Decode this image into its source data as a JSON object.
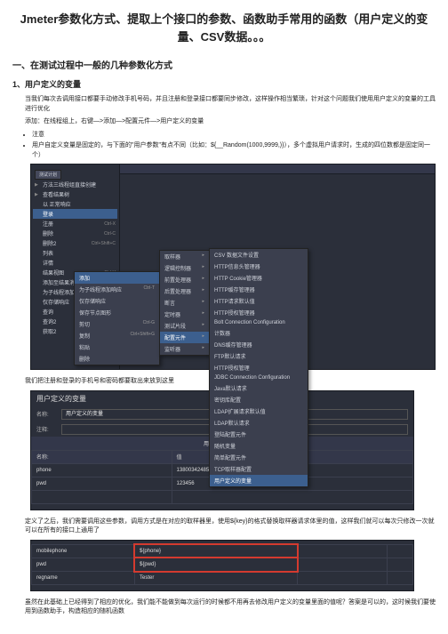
{
  "title": "Jmeter参数化方式、提取上个接口的参数、函数助手常用的函数（用户定义的变量、CSV数据。。。",
  "sec1_h2": "一、在测试过程中一般的几种参数化方式",
  "sec1_h3": "1、用户定义的变量",
  "p1": "当我们每次去调用接口都要手动修改手机号码，并且注册和登录接口都要同步修改，这样操作相当繁琐，针对这个问题我们使用用户定义的变量的工具进行优化",
  "p2": "添加：在线程组上，右键—>添加—>配置元件—>用户定义的变量",
  "b1": "注意",
  "b2": "用户自定义变量是固定的，与下面的\"用户参数\"有点不同（比如：${__Random(1000,9999,)}），多个虚拟用户请求时，生成的四位数都是固定同一个）",
  "tree": [
    "测试计划",
    "▶ 方法三线程组直接创建",
    "▶ 查看结果树",
    "以 正常响应",
    "登录",
    "注册",
    "删除",
    "删除2",
    "列表",
    "详情",
    "结果视图",
    "添加至结果消息",
    "为子线程添加响应断言",
    "仅存储响应",
    "查询",
    "查询2",
    "获取2"
  ],
  "tree_keys": [
    "",
    "",
    "",
    "",
    "",
    "Ctrl-X",
    "Ctrl-C",
    "Ctrl+Shift+C",
    "",
    "",
    "Ctrl-V",
    "",
    "",
    "",
    "",
    "",
    ""
  ],
  "ctx1": [
    [
      "添加",
      ""
    ],
    [
      "为子线程添加响应",
      "Ctrl-T"
    ],
    [
      "仅存储响应",
      ""
    ],
    [
      "保存节点图形",
      ""
    ],
    [
      "剪切",
      "Ctrl-G"
    ],
    [
      "复制",
      "Ctrl+Shift+G"
    ],
    [
      "粘贴",
      ""
    ],
    [
      "删除",
      ""
    ]
  ],
  "ctx2": [
    "取样器",
    "逻辑控制器",
    "前置处理器",
    "后置处理器",
    "断言",
    "定时器",
    "测试片段",
    "配置元件",
    "监听器"
  ],
  "ctx2_hl_index": 7,
  "ctx3": [
    "CSV 数据文件设置",
    "HTTP信息头管理器",
    "HTTP Cookie管理器",
    "HTTP缓存管理器",
    "HTTP请求默认值",
    "HTTP授权管理器",
    "Bolt Connection Configuration",
    "计数器",
    "DNS缓存管理器",
    "FTP默认请求",
    "HTTP授权管理",
    "JDBC Connection Configuration",
    "Java默认请求",
    "密钥库配置",
    "LDAP扩展请求默认值",
    "LDAP默认请求",
    "登陆配置元件",
    "随机变量",
    "简单配置元件",
    "TCP取样器配置",
    "用户定义的变量"
  ],
  "p3": "我们把注册和登录的手机号和密码都要取出来放到这里",
  "shot2": {
    "panelTitle": "用户定义的变量",
    "labelName": "名称:",
    "fieldName": "用户定义的变量",
    "labelComment": "注释:",
    "tableTitle": "用户定义的变量",
    "cols": [
      "名称:",
      "值"
    ],
    "rows": [
      [
        "phone",
        "13800342485"
      ],
      [
        "pwd",
        "123456"
      ]
    ]
  },
  "p4": "定义了之后，我们需要调用这些参数，调用方式是在对应的取样器里，使用${key}的格式替换取样器请求体里的值，这样我们就可以每次只修改一次就可以在所有的接口上通用了",
  "shot3": {
    "rows": [
      [
        "mobilephone",
        "${phone}"
      ],
      [
        "pwd",
        "${pwd}"
      ],
      [
        "regname",
        "Tester"
      ]
    ]
  },
  "p5": "虽然在此基础上已经得到了相应的优化，我们能不能做到每次运行的时候都不用再去修改用户定义的变量里面的值呢？答案是可以的，这时候我们要使用到函数助手，构造相应的随机函数"
}
